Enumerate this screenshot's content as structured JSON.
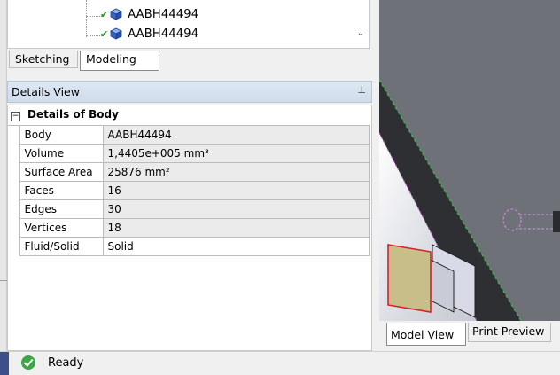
{
  "tree": {
    "items": [
      {
        "label": "AABH44494"
      },
      {
        "label": "AABH44494"
      }
    ]
  },
  "tabs": {
    "sketching": "Sketching",
    "modeling": "Modeling"
  },
  "details_view": {
    "title": "Details View",
    "pin": "ᵖ",
    "group": "Details of Body",
    "toggle": "−",
    "rows": [
      {
        "key": "Body",
        "value": "AABH44494"
      },
      {
        "key": "Volume",
        "value": "1,4405e+005 mm³"
      },
      {
        "key": "Surface Area",
        "value": "25876 mm²"
      },
      {
        "key": "Faces",
        "value": "16"
      },
      {
        "key": "Edges",
        "value": "30"
      },
      {
        "key": "Vertices",
        "value": "18"
      },
      {
        "key": "Fluid/Solid",
        "value": "Solid"
      }
    ]
  },
  "viewport_tabs": {
    "model_view": "Model View",
    "print_preview": "Print Preview"
  },
  "status": {
    "text": "Ready"
  },
  "colors": {
    "viewport_bg": "#6e7178",
    "header_bg": "#d6e2ef",
    "check_green": "#1f9e1f",
    "status_ok": "#3aa845"
  }
}
